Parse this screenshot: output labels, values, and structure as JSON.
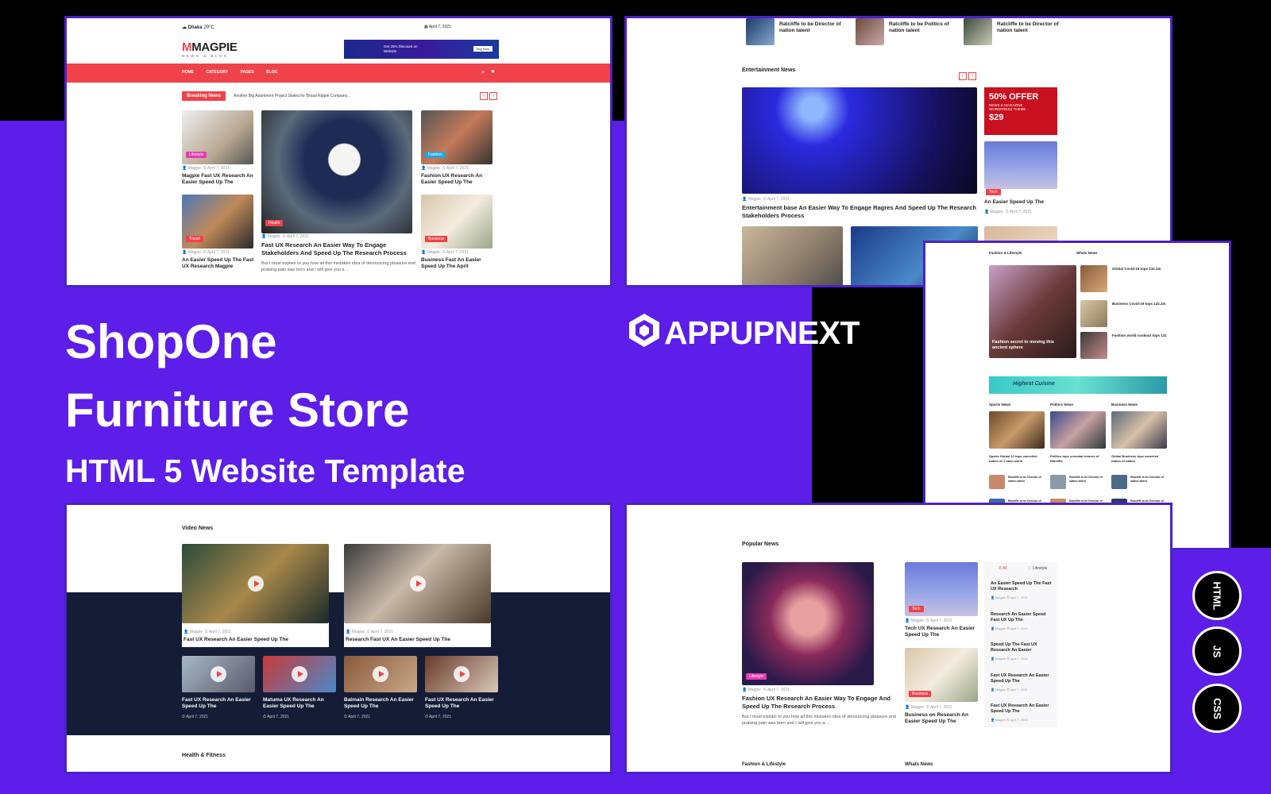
{
  "hero": {
    "line1": "ShopOne",
    "line2": "Furniture Store",
    "line3": "HTML 5 Website Template"
  },
  "brand": {
    "name": "APPUPNEXT"
  },
  "badges": [
    "HTML",
    "JS",
    "CSS"
  ],
  "panel_top_left": {
    "location": "Dhaka",
    "temp": "29°C",
    "date": "April 7, 2021",
    "logo": "MAGPIE",
    "logo_sub": "NEWS & BLOG",
    "banner_text": "Get 25% Discount on Website",
    "banner_button": "Buy Now",
    "nav": [
      "HOME",
      "CATEGORY",
      "PAGES",
      "BLOG"
    ],
    "breaking_label": "Breaking News",
    "breaking_text": "Another Big Apartment Project Slated for Broad Ripple Company...",
    "cards": [
      {
        "tag": "Lifestyle",
        "title": "Magpie Fast UX Research An Easier Speed Up The"
      },
      {
        "tag": "Fashion",
        "title": "Fashion UX Research An Easier Speed Up The"
      },
      {
        "tag": "Travel",
        "title": "An Easier Speed Up The Fast UX Research Magpie"
      },
      {
        "tag": "Business",
        "title": "Business Fast An Easier Speed Up The April"
      }
    ],
    "main_card": {
      "tag": "Health",
      "title": "Fast UX Research An Easier Way To Engage Stakeholders And Speed Up The Research Process",
      "excerpt": "But I must explain to you how all this mistaken idea of denouncing pleasure and praising pain was born and I will give you a ..."
    },
    "meta_author": "Magpie",
    "meta_date": "April 7, 2021"
  },
  "panel_top_right": {
    "strip": [
      "Ratcliffe to be Director of nation talent",
      "Ratcliffe to be Politics of nation talent",
      "Ratcliffe to be Director of nation talent"
    ],
    "section": "Entertainment News",
    "main_title": "Entertainment base An Easier Way To Engage Ragres And Speed Up The Research Stakeholders Process",
    "ad_line1": "50% OFFER",
    "ad_line2": "NEWS & MAGAZINE WORDPRESS THEME",
    "ad_price": "$29",
    "side_tag": "Tech",
    "side_title": "An Easier Speed Up The"
  },
  "panel_mid_right": {
    "left_section": "Fashion & Lifestyle",
    "right_section": "Whats News",
    "feature_title": "Fashion secret to moving this ancient sphere",
    "news": [
      "Global Covid-19 tops 132.2m",
      "Business Covid-19 tops 132.2m",
      "Fashion world cookout tops 131"
    ],
    "banner": "Highest Cuisine",
    "cols": [
      "Sports News",
      "Politics News",
      "Business News"
    ],
    "col_titles": [
      "Sports Global 12 tops cancelled nation of 1 base world",
      "Politics tops crossbat rumors of Ratcliffe",
      "Global Business tops canceled nation of nation"
    ]
  },
  "panel_bottom_left": {
    "section": "Video News",
    "big": [
      "Fast UX Research An Easier Speed Up The",
      "Research Fast UX An Easier Speed Up The"
    ],
    "small": [
      "Fast UX Research An Easier Speed Up The",
      "Matuma UX Research An Easier Speed Up The",
      "Balmain Research An Easier Speed Up The",
      "Fast UX Research An Easier Speed Up The"
    ],
    "date": "April 7, 2021",
    "next_section": "Health & Fitness"
  },
  "panel_bottom_right": {
    "section": "Popular News",
    "main_tag": "Lifestyle",
    "main_title": "Fashion UX Research An Easier Way To Engage And Speed Up The Research Process",
    "main_excerpt": "But I must explain to you how all this mistaken idea of denouncing pleasure and praising pain was born and I will give you a ...",
    "side": [
      {
        "tag": "Tech",
        "title": "Tech UX Research An Easier Speed Up The"
      },
      {
        "tag": "Business",
        "title": "Business on Research An Easier Speed Up The"
      }
    ],
    "tabs": [
      "All",
      "Lifestyle"
    ],
    "list": [
      "An Easier Speed Up The Fast UX Research",
      "Research An Easier Speed Fast UX Up The",
      "Speed Up The Fast UX Research An Easier",
      "Fast UX Research An Easier Speed Up The",
      "Fast UX Research An Easier Speed Up The"
    ],
    "footer_left": "Fashion & Lifestyle",
    "footer_right": "Whats News"
  },
  "colors": {
    "accent": "#f0424a",
    "purple": "#5c1ee8",
    "navy": "#141c36"
  }
}
